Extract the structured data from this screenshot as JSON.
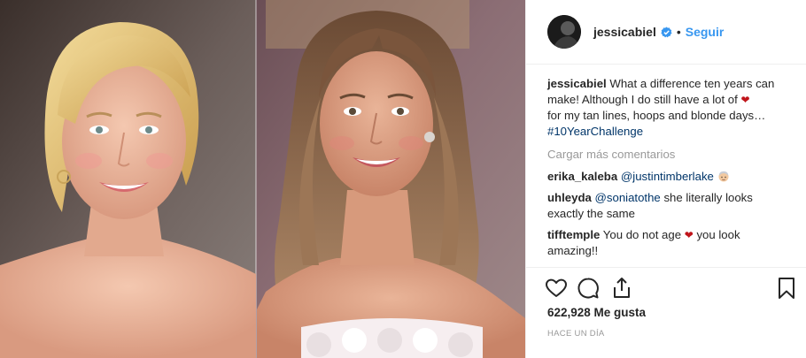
{
  "post": {
    "image_alt": "Before and after photos of a smiling woman",
    "author": {
      "username": "jessicabiel",
      "verified": true,
      "verified_icon": "verified-badge-icon",
      "separator": "•",
      "follow_label": "Seguir"
    },
    "caption": {
      "username": "jessicabiel",
      "text_before_heart": "What a difference ten years can make! Although I do still have a lot of",
      "heart_icon": "red-heart-emoji",
      "text_after_heart": "for my tan lines, hoops and blonde days…",
      "hashtag": "#10YearChallenge"
    },
    "load_more_label": "Cargar más comentarios",
    "comments": [
      {
        "username": "erika_kaleba",
        "mention": "@justintimberlake",
        "text": "",
        "emoji": "old-woman-emoji"
      },
      {
        "username": "uhleyda",
        "mention": "@soniatothe",
        "text": "she literally looks exactly the same"
      },
      {
        "username": "tifftemple",
        "text_before_heart": "You do not age",
        "heart_icon": "red-heart-emoji",
        "text_after_heart": "you look amazing!!"
      }
    ],
    "actions": {
      "like_icon": "heart-outline-icon",
      "comment_icon": "comment-bubble-icon",
      "share_icon": "share-upload-icon",
      "save_icon": "bookmark-icon"
    },
    "likes_label": "622,928 Me gusta",
    "timestamp": "HACE UN DÍA",
    "colors": {
      "link_blue": "#3897f0",
      "mention_blue": "#003569",
      "muted_gray": "#999999",
      "text": "#262626",
      "heart_red": "#c0151b"
    }
  }
}
